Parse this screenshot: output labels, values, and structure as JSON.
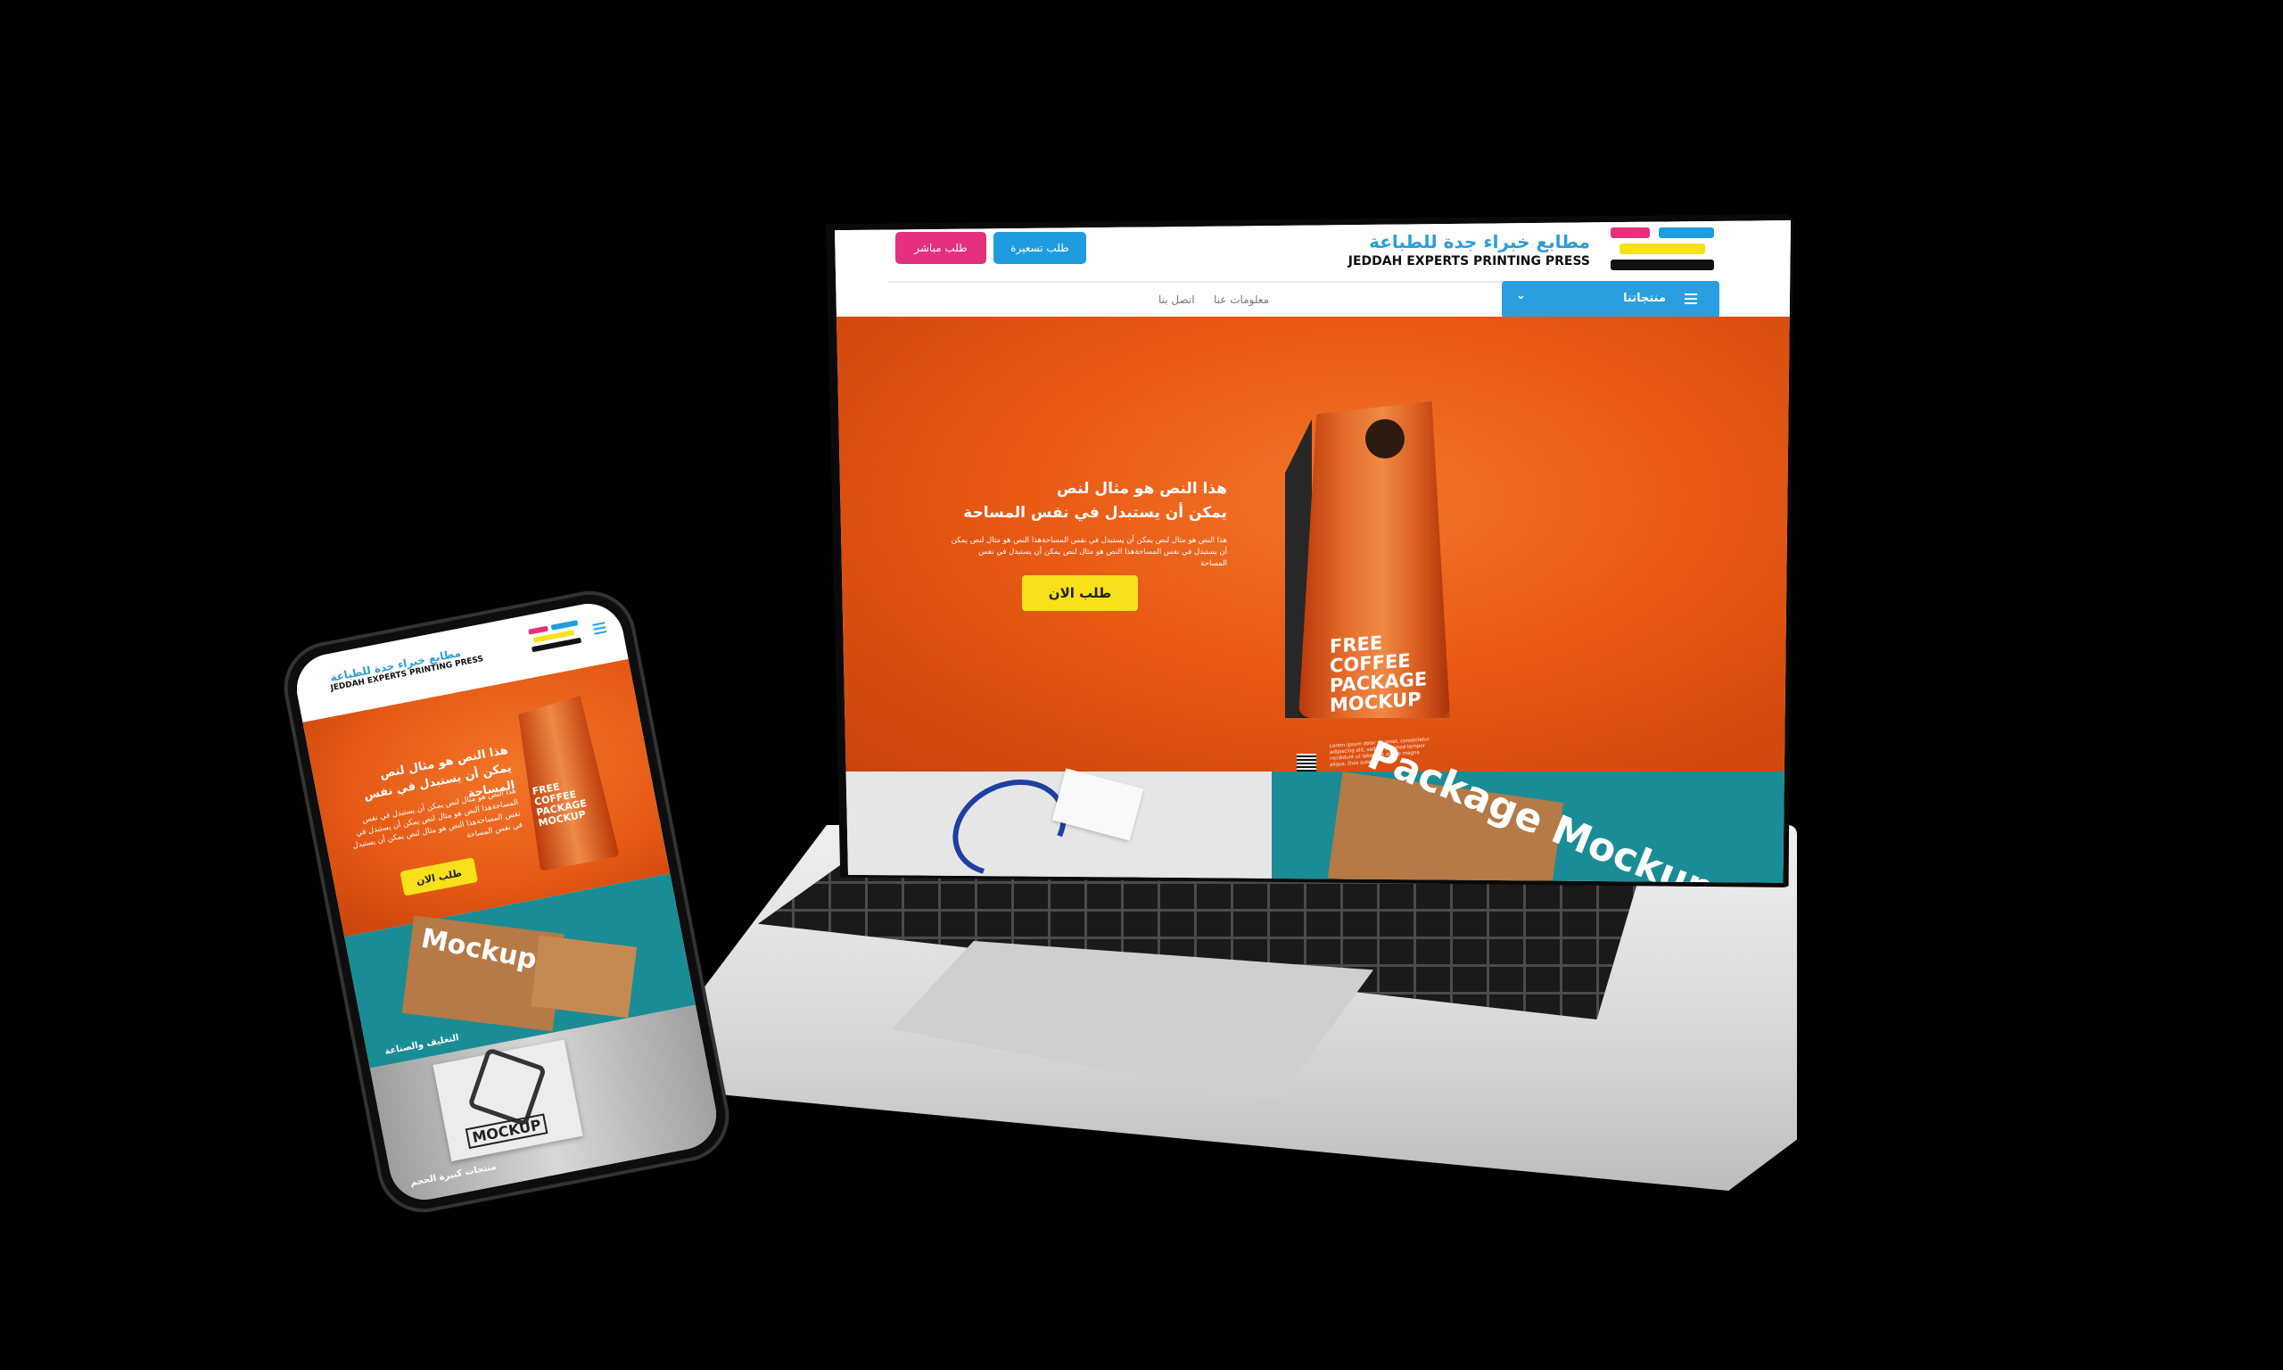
{
  "site": {
    "logo_arabic": "مطابع خبراء جدة للطباعة",
    "logo_english": "JEDDAH EXPERTS PRINTING PRESS",
    "brand_colors": [
      "#e5307e",
      "#1f9ce0",
      "#f7e11a",
      "#111111"
    ]
  },
  "header": {
    "direct_order_label": "طلب مباشر",
    "quote_request_label": "طلب تسعيرة",
    "products_menu_label": "منتجاتنا",
    "nav": [
      "معلومات عنا",
      "اتصل بنا"
    ]
  },
  "hero": {
    "title_line1": "هذا النص هو مثال لنص",
    "title_line2": "يمكن أن يستبدل في نفس المساحة",
    "subtitle": "هذا النص هو مثال لنص يمكن أن يستبدل في نفس المساحةهذا النص هو مثال لنص يمكن أن يستبدل في نفس المساحةهذا النص هو مثال لنص يمكن أن يستبدل في نفس المساحة",
    "cta_label": "طلب الان",
    "product_text_line1": "FREE",
    "product_text_line2": "COFFEE",
    "product_text_line3": "PACKAGE",
    "product_text_line4": "MOCKUP",
    "product_fine_print": "Lorem ipsum dolor sit amet, consectetur adipiscing elit, sed do eiusmod tempor incididunt ut labore et dolore magna aliqua. Duis autem."
  },
  "mobile": {
    "packaging_mockup_text": "Mockup",
    "packaging_caption": "التغليف والصناعة",
    "logo_mockup_text": "MOCKUP",
    "bulk_caption": "منتجات كبيرة الحجم"
  },
  "laptop_strip": {
    "packaging_mockup_text": "Package Mockup"
  }
}
